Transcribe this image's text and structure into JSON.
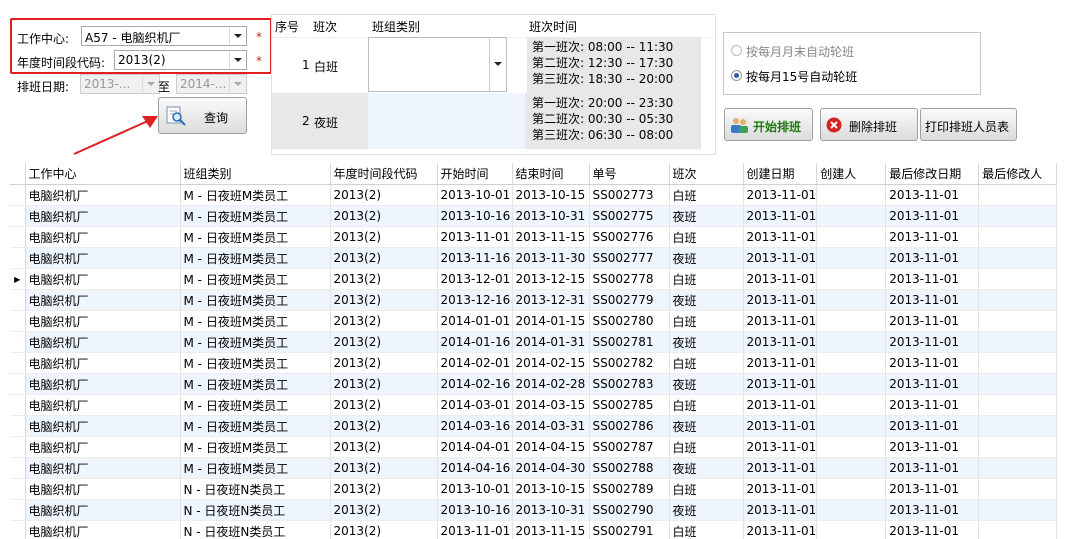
{
  "filters": {
    "work_center_label": "工作中心:",
    "work_center_value": "A57 - 电脑织机厂",
    "period_label": "年度时间段代码:",
    "period_value": "2013(2)",
    "required_mark": "*",
    "date_label": "排班日期:",
    "date_from": "2013-...",
    "date_to_label": "至",
    "date_to": "2014-...",
    "query_label": "查询"
  },
  "shift_table": {
    "headers": [
      "序号",
      "班次",
      "班组类别",
      "班次时间"
    ],
    "rows": [
      {
        "no": "1",
        "shift": "白班",
        "times": [
          "第一班次: 08:00 -- 11:30",
          "第二班次: 12:30 -- 17:30",
          "第三班次: 18:30 -- 20:00"
        ]
      },
      {
        "no": "2",
        "shift": "夜班",
        "times": [
          "第一班次: 20:00 -- 23:30",
          "第二班次: 00:30 -- 05:30",
          "第三班次: 06:30 -- 08:00"
        ]
      }
    ]
  },
  "rotation": {
    "option1": "按每月月末自动轮班",
    "option2": "按每月15号自动轮班",
    "selected": 2
  },
  "actions": {
    "start": "开始排班",
    "delete": "删除排班",
    "print": "打印排班人员表"
  },
  "grid": {
    "headers": [
      "工作中心",
      "班组类别",
      "年度时间段代码",
      "开始时间",
      "结束时间",
      "单号",
      "班次",
      "创建日期",
      "创建人",
      "最后修改日期",
      "最后修改人"
    ],
    "rows": [
      [
        "电脑织机厂",
        "M - 日夜班M类员工",
        "2013(2)",
        "2013-10-01",
        "2013-10-15",
        "SS002773",
        "白班",
        "2013-11-01",
        "",
        "2013-11-01",
        ""
      ],
      [
        "电脑织机厂",
        "M - 日夜班M类员工",
        "2013(2)",
        "2013-10-16",
        "2013-10-31",
        "SS002775",
        "夜班",
        "2013-11-01",
        "",
        "2013-11-01",
        ""
      ],
      [
        "电脑织机厂",
        "M - 日夜班M类员工",
        "2013(2)",
        "2013-11-01",
        "2013-11-15",
        "SS002776",
        "白班",
        "2013-11-01",
        "",
        "2013-11-01",
        ""
      ],
      [
        "电脑织机厂",
        "M - 日夜班M类员工",
        "2013(2)",
        "2013-11-16",
        "2013-11-30",
        "SS002777",
        "夜班",
        "2013-11-01",
        "",
        "2013-11-01",
        ""
      ],
      [
        "电脑织机厂",
        "M - 日夜班M类员工",
        "2013(2)",
        "2013-12-01",
        "2013-12-15",
        "SS002778",
        "白班",
        "2013-11-01",
        "",
        "2013-11-01",
        ""
      ],
      [
        "电脑织机厂",
        "M - 日夜班M类员工",
        "2013(2)",
        "2013-12-16",
        "2013-12-31",
        "SS002779",
        "夜班",
        "2013-11-01",
        "",
        "2013-11-01",
        ""
      ],
      [
        "电脑织机厂",
        "M - 日夜班M类员工",
        "2013(2)",
        "2014-01-01",
        "2014-01-15",
        "SS002780",
        "白班",
        "2013-11-01",
        "",
        "2013-11-01",
        ""
      ],
      [
        "电脑织机厂",
        "M - 日夜班M类员工",
        "2013(2)",
        "2014-01-16",
        "2014-01-31",
        "SS002781",
        "夜班",
        "2013-11-01",
        "",
        "2013-11-01",
        ""
      ],
      [
        "电脑织机厂",
        "M - 日夜班M类员工",
        "2013(2)",
        "2014-02-01",
        "2014-02-15",
        "SS002782",
        "白班",
        "2013-11-01",
        "",
        "2013-11-01",
        ""
      ],
      [
        "电脑织机厂",
        "M - 日夜班M类员工",
        "2013(2)",
        "2014-02-16",
        "2014-02-28",
        "SS002783",
        "夜班",
        "2013-11-01",
        "",
        "2013-11-01",
        ""
      ],
      [
        "电脑织机厂",
        "M - 日夜班M类员工",
        "2013(2)",
        "2014-03-01",
        "2014-03-15",
        "SS002785",
        "白班",
        "2013-11-01",
        "",
        "2013-11-01",
        ""
      ],
      [
        "电脑织机厂",
        "M - 日夜班M类员工",
        "2013(2)",
        "2014-03-16",
        "2014-03-31",
        "SS002786",
        "夜班",
        "2013-11-01",
        "",
        "2013-11-01",
        ""
      ],
      [
        "电脑织机厂",
        "M - 日夜班M类员工",
        "2013(2)",
        "2014-04-01",
        "2014-04-15",
        "SS002787",
        "白班",
        "2013-11-01",
        "",
        "2013-11-01",
        ""
      ],
      [
        "电脑织机厂",
        "M - 日夜班M类员工",
        "2013(2)",
        "2014-04-16",
        "2014-04-30",
        "SS002788",
        "夜班",
        "2013-11-01",
        "",
        "2013-11-01",
        ""
      ],
      [
        "电脑织机厂",
        "N - 日夜班N类员工",
        "2013(2)",
        "2013-10-01",
        "2013-10-15",
        "SS002789",
        "白班",
        "2013-11-01",
        "",
        "2013-11-01",
        ""
      ],
      [
        "电脑织机厂",
        "N - 日夜班N类员工",
        "2013(2)",
        "2013-10-16",
        "2013-10-31",
        "SS002790",
        "夜班",
        "2013-11-01",
        "",
        "2013-11-01",
        ""
      ],
      [
        "电脑织机厂",
        "N - 日夜班N类员工",
        "2013(2)",
        "2013-11-01",
        "2013-11-15",
        "SS002791",
        "白班",
        "2013-11-01",
        "",
        "2013-11-01",
        ""
      ]
    ],
    "current_row": 4
  },
  "colors": {
    "highlight": "#e02020",
    "row_alt": "#eef5fd",
    "start_button_text": "#1f7a12",
    "delete_icon": "#d42323"
  }
}
